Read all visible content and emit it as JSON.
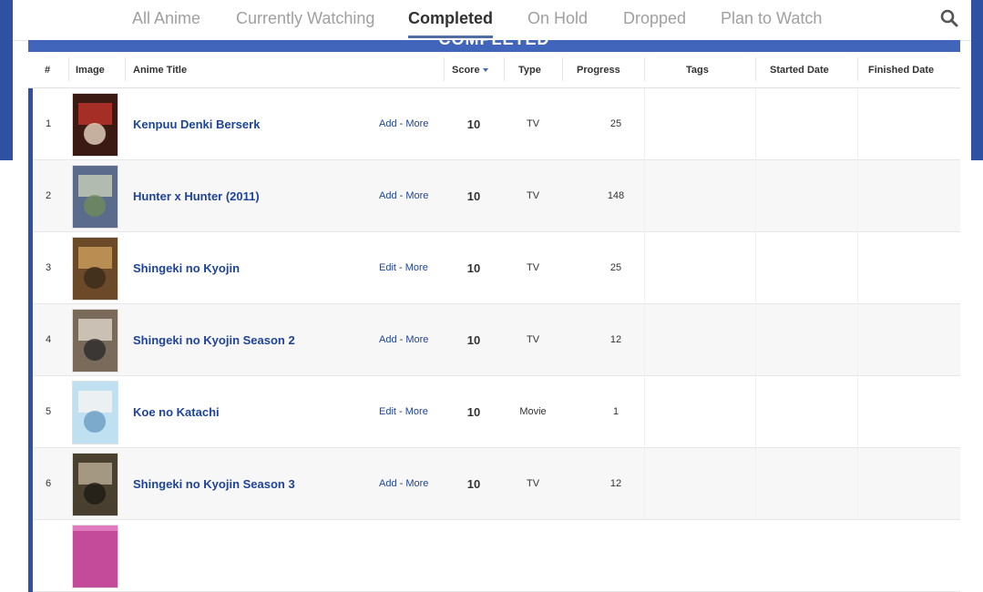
{
  "nav": {
    "tabs": [
      {
        "label": "All Anime"
      },
      {
        "label": "Currently Watching"
      },
      {
        "label": "Completed"
      },
      {
        "label": "On Hold"
      },
      {
        "label": "Dropped"
      },
      {
        "label": "Plan to Watch"
      }
    ],
    "active_tab": "Completed",
    "search_icon": "search-icon"
  },
  "status_header": "COMPLETED",
  "table": {
    "columns": {
      "num": "#",
      "image": "Image",
      "title": "Anime Title",
      "score": "Score",
      "type": "Type",
      "progress": "Progress",
      "tags": "Tags",
      "started": "Started Date",
      "finished": "Finished Date"
    },
    "rows": [
      {
        "num": "1",
        "title": "Kenpuu Denki Berserk",
        "action": "Add",
        "more": "More",
        "score": "10",
        "type": "TV",
        "progress": "25"
      },
      {
        "num": "2",
        "title": "Hunter x Hunter (2011)",
        "action": "Add",
        "more": "More",
        "score": "10",
        "type": "TV",
        "progress": "148"
      },
      {
        "num": "3",
        "title": "Shingeki no Kyojin",
        "action": "Edit",
        "more": "More",
        "score": "10",
        "type": "TV",
        "progress": "25"
      },
      {
        "num": "4",
        "title": "Shingeki no Kyojin Season 2",
        "action": "Add",
        "more": "More",
        "score": "10",
        "type": "TV",
        "progress": "12"
      },
      {
        "num": "5",
        "title": "Koe no Katachi",
        "action": "Edit",
        "more": "More",
        "score": "10",
        "type": "Movie",
        "progress": "1"
      },
      {
        "num": "6",
        "title": "Shingeki no Kyojin Season 3",
        "action": "Add",
        "more": "More",
        "score": "10",
        "type": "TV",
        "progress": "12"
      }
    ]
  },
  "colors": {
    "brand_blue": "#2e51a2",
    "link_blue": "#1d439b",
    "header_bar": "#4065ba",
    "active_underline": "#4f6ca3"
  }
}
